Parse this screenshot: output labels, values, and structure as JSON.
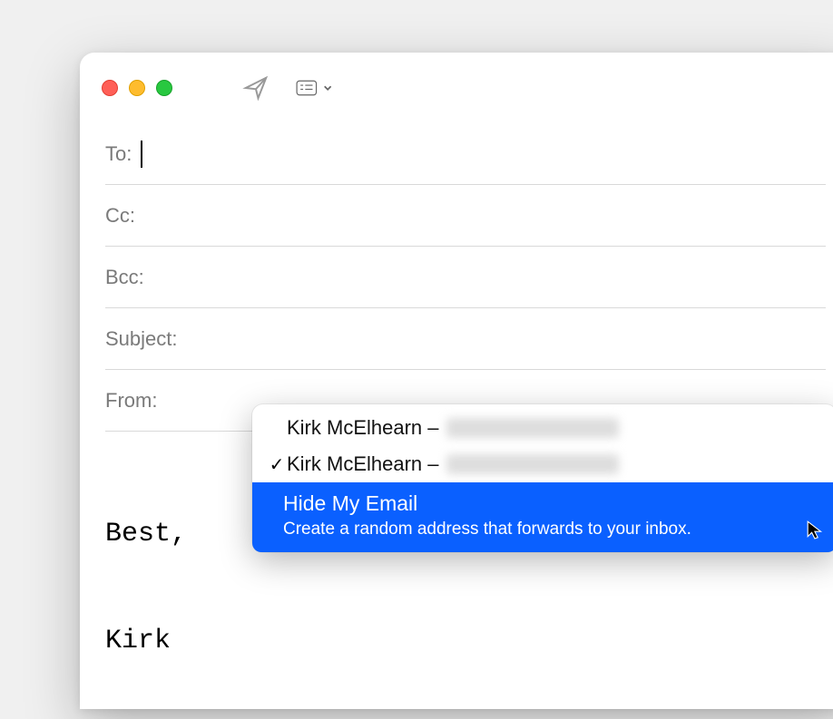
{
  "fields": {
    "to_label": "To:",
    "cc_label": "Cc:",
    "bcc_label": "Bcc:",
    "subject_label": "Subject:",
    "from_label": "From:"
  },
  "from_menu": {
    "items": [
      {
        "name": "Kirk McElhearn –",
        "selected": false
      },
      {
        "name": "Kirk McElhearn –",
        "selected": true
      }
    ],
    "hide": {
      "title": "Hide My Email",
      "subtitle": "Create a random address that forwards to your inbox."
    }
  },
  "body": {
    "line1": "Best,",
    "line2": "Kirk"
  }
}
